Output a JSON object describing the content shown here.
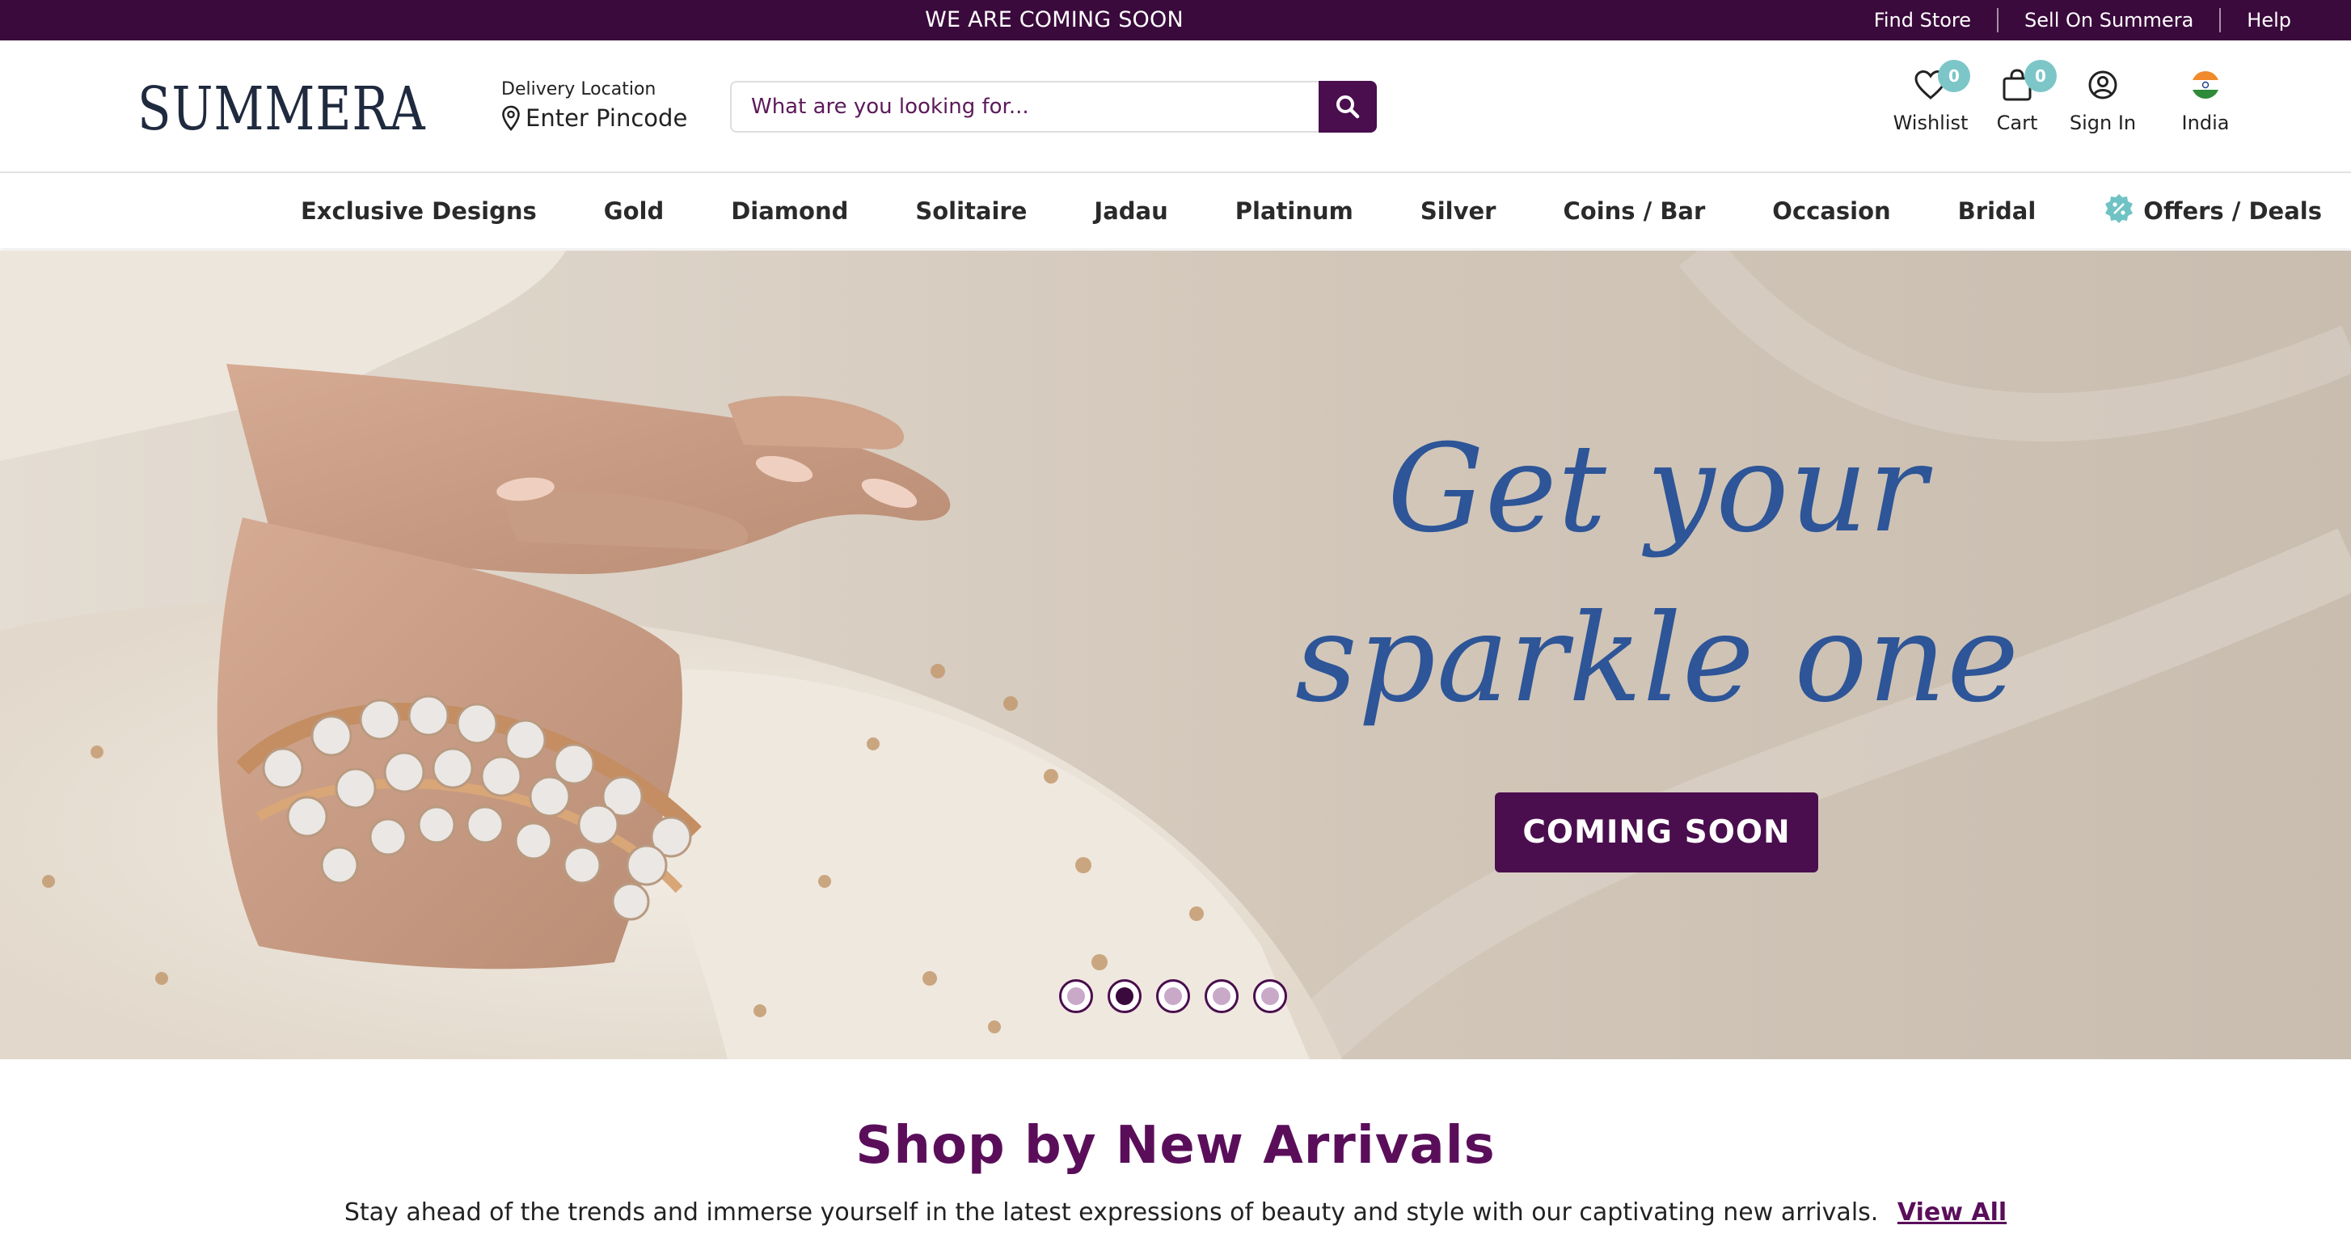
{
  "topbar": {
    "announcement": "WE ARE COMING SOON",
    "links": [
      "Find Store",
      "Sell On Summera",
      "Help"
    ]
  },
  "header": {
    "brand": "SUMMERA",
    "delivery_label": "Delivery Location",
    "delivery_value": "Enter Pincode",
    "search_placeholder": "What are you looking for...",
    "icons": {
      "wishlist_label": "Wishlist",
      "wishlist_count": "0",
      "cart_label": "Cart",
      "cart_count": "0",
      "signin_label": "Sign In",
      "country_label": "India"
    }
  },
  "nav": {
    "items": [
      "Exclusive Designs",
      "Gold",
      "Diamond",
      "Solitaire",
      "Jadau",
      "Platinum",
      "Silver",
      "Coins / Bar",
      "Occasion",
      "Bridal",
      "Offers / Deals"
    ]
  },
  "hero": {
    "headline_line1": "Get your",
    "headline_line2": "sparkle one",
    "cta": "COMING SOON",
    "slides_total": 5,
    "active_slide": 2
  },
  "section": {
    "title": "Shop by New Arrivals",
    "description": "Stay ahead of the trends and immerse yourself in the latest expressions of beauty and style with our captivating new arrivals.",
    "link": "View All"
  },
  "colors": {
    "brand_purple": "#4a0e4e",
    "topbar_bg": "#3a0a3c",
    "badge_teal": "#7cc6c8",
    "headline_blue": "#2d5597",
    "title_purple": "#5a0e5a"
  }
}
